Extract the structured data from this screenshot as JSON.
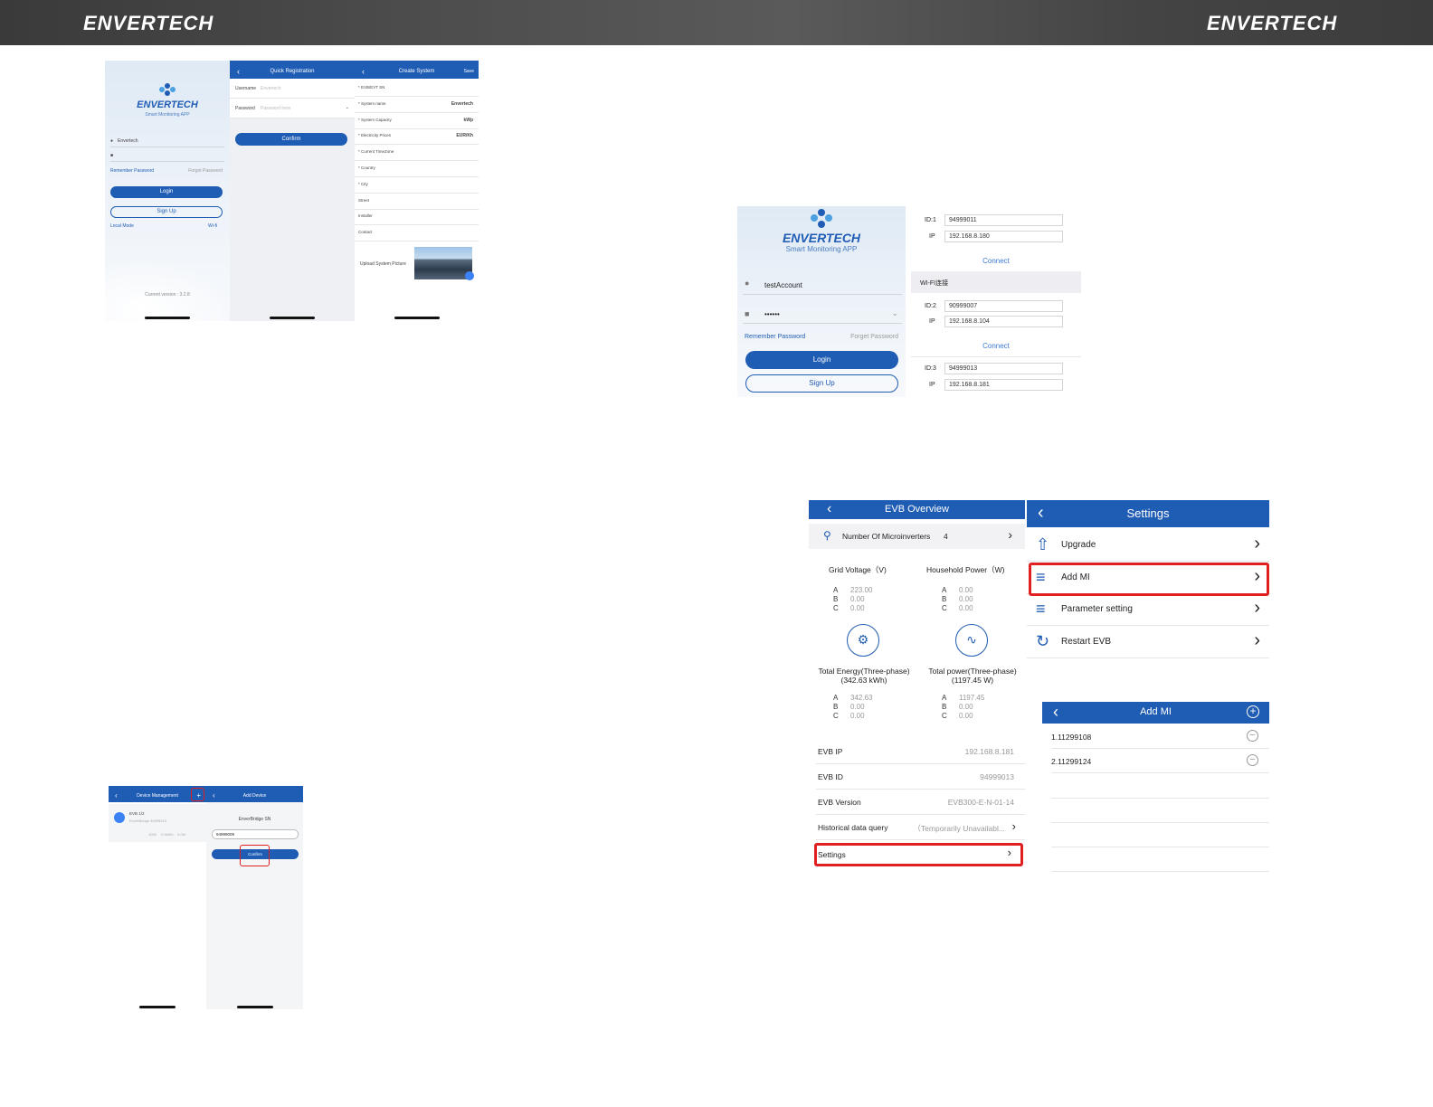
{
  "brand": {
    "left": "ENVERTECH",
    "right": "ENVERTECH"
  },
  "colors": {
    "primary": "#1f5cb4",
    "highlight": "#e02020",
    "header": "#4a4a4a"
  },
  "login_small": {
    "logo": "ENVERTECH",
    "subtitle": "Smart Monitoring APP",
    "username": "Envertech",
    "remember": "Remember Password",
    "forgot": "Forgot Password",
    "login": "Login",
    "signup": "Sign Up",
    "local_mode": "Local Mode",
    "wifi": "Wi-fi",
    "version": "Current version : 3.2.8"
  },
  "quick_reg": {
    "title": "Quick Registration",
    "username_label": "Username",
    "username_ph": "Envertech",
    "password_label": "Password",
    "password_ph": "Password here",
    "confirm": "Confirm"
  },
  "create_system": {
    "title": "Create System",
    "save": "Save",
    "rows": [
      {
        "label": "* EVB/EVT SN",
        "value": ""
      },
      {
        "label": "* System name",
        "value": "Envertech"
      },
      {
        "label": "* System Capacity",
        "value": "kWp"
      },
      {
        "label": "* Electricity Prices",
        "value": "EUR/Kh"
      },
      {
        "label": "* Current TimeZone",
        "value": ""
      },
      {
        "label": "* Country",
        "value": ""
      },
      {
        "label": "* City",
        "value": ""
      },
      {
        "label": "Street",
        "value": ""
      },
      {
        "label": "Installer",
        "value": ""
      },
      {
        "label": "Contact",
        "value": ""
      }
    ],
    "upload": "Upload System Picture"
  },
  "login_large": {
    "logo": "ENVERTECH",
    "subtitle": "Smart Monitoring APP",
    "username": "testAccount",
    "password": "••••••",
    "remember": "Remember Password",
    "forgot": "Forget Password",
    "login": "Login",
    "signup": "Sign Up"
  },
  "local_list": {
    "items": [
      {
        "id_label": "ID:1",
        "id": "94999011",
        "ip_label": "IP",
        "ip": "192.168.8.180"
      },
      {
        "id_label": "ID:2",
        "id": "90999007",
        "ip_label": "IP",
        "ip": "192.168.8.104"
      },
      {
        "id_label": "ID:3",
        "id": "94999013",
        "ip_label": "IP",
        "ip": "192.168.8.181"
      }
    ],
    "connect": "Connect",
    "wifi_section": "WI-FI连接"
  },
  "evb": {
    "title": "EVB Overview",
    "micro": "Number Of Microinverters",
    "micro_count": "4",
    "grid_title": "Grid Voltage（V)",
    "house_title": "Household Power（W)",
    "grid": [
      {
        "p": "A",
        "v": "223.00"
      },
      {
        "p": "B",
        "v": "0.00"
      },
      {
        "p": "C",
        "v": "0.00"
      }
    ],
    "house": [
      {
        "p": "A",
        "v": "0.00"
      },
      {
        "p": "B",
        "v": "0.00"
      },
      {
        "p": "C",
        "v": "0.00"
      }
    ],
    "energy_title": "Total Energy(Three-phase)",
    "energy_sub": "(342.63 kWh)",
    "power_title": "Total power(Three-phase)",
    "power_sub": "(1197.45 W)",
    "energy": [
      {
        "p": "A",
        "v": "342.63"
      },
      {
        "p": "B",
        "v": "0.00"
      },
      {
        "p": "C",
        "v": "0.00"
      }
    ],
    "power": [
      {
        "p": "A",
        "v": "1197.45"
      },
      {
        "p": "B",
        "v": "0.00"
      },
      {
        "p": "C",
        "v": "0.00"
      }
    ],
    "info": [
      {
        "label": "EVB IP",
        "value": "192.168.8.181"
      },
      {
        "label": "EVB ID",
        "value": "94999013"
      },
      {
        "label": "EVB Version",
        "value": "EVB300-E-N-01-14"
      },
      {
        "label": "Historical data query",
        "value": "（Temporarily Unavailabl..."
      }
    ],
    "settings": "Settings"
  },
  "settings": {
    "title": "Settings",
    "items": [
      {
        "label": "Upgrade",
        "icon": "upload-arrow-icon"
      },
      {
        "label": "Add MI",
        "icon": "sliders-icon"
      },
      {
        "label": "Parameter setting",
        "icon": "sliders-icon"
      },
      {
        "label": "Restart EVB",
        "icon": "refresh-icon"
      }
    ]
  },
  "add_mi": {
    "title": "Add MI",
    "items": [
      "1.11299108",
      "2.11299124"
    ]
  },
  "device_mgmt": {
    "title": "Device Management",
    "device_name": "EVB 1/2",
    "device_sub": "EnverBridge 94999013",
    "stats": [
      "1000",
      "0.0kWh",
      "0.0W"
    ]
  },
  "add_device": {
    "title": "Add Device",
    "sn_label": "EnverBridge SN",
    "sn_value": "94999009",
    "confirm": "Confirm"
  }
}
